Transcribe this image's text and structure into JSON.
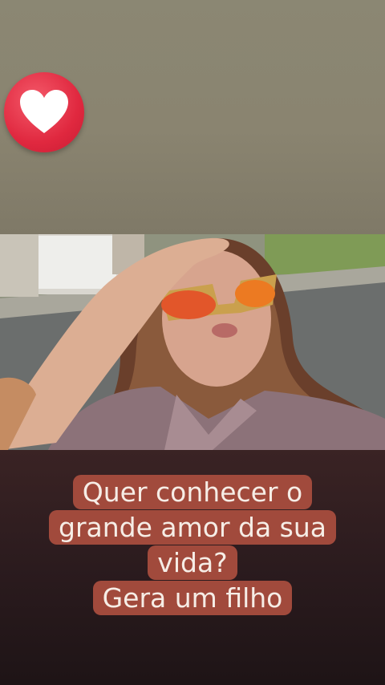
{
  "sticker": {
    "icon": "heart-icon",
    "color": "#e0283f"
  },
  "caption": {
    "lines": [
      "Quer conhecer o",
      "grande amor da sua",
      "vida?",
      "Gera um filho"
    ],
    "highlight_color": "#a14a3c",
    "text_color": "#f6ede6"
  }
}
